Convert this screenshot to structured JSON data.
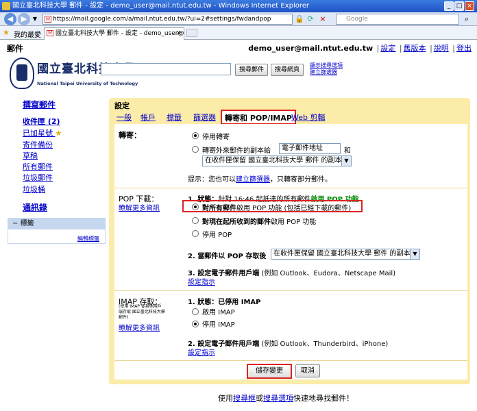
{
  "browser": {
    "window_title": "國立臺北科技大學 郵件 - 設定 - demo_user@mail.ntut.edu.tw - Windows Internet Explorer",
    "url": "https://mail.google.com/a/mail.ntut.edu.tw/?ui=2#settings/fwdandpop",
    "search_placeholder": "Google",
    "favorites_label": "我的最愛",
    "tab_title": "國立臺北科技大學 郵件 - 設定 - demo_user@mail.nt..."
  },
  "header": {
    "app_name": "郵件",
    "user_email": "demo_user@mail.ntut.edu.tw",
    "links": [
      "設定",
      "舊版本",
      "說明",
      "登出"
    ]
  },
  "logo": {
    "chinese": "國立臺北科技大學",
    "english": "National Taipei University of Technology"
  },
  "search": {
    "search_mail": "搜尋郵件",
    "search_web": "搜尋網頁",
    "options_line1": "顯示搜尋選項",
    "options_line2": "建立篩選器"
  },
  "sidebar": {
    "compose": "撰寫郵件",
    "inbox": "收件匣 (2)",
    "items": [
      "已加星號",
      "寄件備份",
      "草稿",
      "所有郵件",
      "垃圾郵件",
      "垃圾桶"
    ],
    "contacts": "通訊錄",
    "labels_title": "標籤",
    "labels_edit": "編輯標籤"
  },
  "settings": {
    "title": "設定",
    "tabs": [
      "一般",
      "帳戶",
      "標籤",
      "篩選器",
      "轉寄和 POP/IMAP",
      "Web 剪輯"
    ],
    "forwarding": {
      "label": "轉寄：",
      "disable": "停用轉寄",
      "forward_copy": "轉寄外來郵件的副本給",
      "email_input": "電子郵件地址",
      "and": "和",
      "keep_option": "在收件匣保留 國立臺北科技大學 郵件 的副本",
      "tip_prefix": "提示：您也可以",
      "tip_link": "建立篩選器",
      "tip_suffix": "，只轉寄部分郵件。"
    },
    "pop": {
      "label": "POP 下載：",
      "learn_more": "瞭解更多資訊",
      "status_prefix": "1. 狀態：",
      "status_text": "針對 16:46 起抵達的所有郵件",
      "status_enabled": "啟用 POP 功能",
      "opt_all_bold": "對所有郵件",
      "opt_all_rest": "啟用 POP 功能 (包括已經下載的郵件)",
      "opt_now_bold": "對現在起所收到的郵件",
      "opt_now_rest": "啟用 POP 功能",
      "opt_disable": "停用 POP",
      "step2": "2. 當郵件以 POP 存取後",
      "step2_select": "在收件匣保留 國立臺北科技大學 郵件 的副本",
      "step3": "3. 設定電子郵件用戶端",
      "step3_clients": "(例如 Outlook、Eudora、Netscape Mail)",
      "step3_link": "設定指示"
    },
    "imap": {
      "label": "IMAP 存取：",
      "note": "(使用 IMAP 從其他用戶端存取 國立臺北科技大學 郵件)",
      "learn_more": "瞭解更多資訊",
      "status_prefix": "1. 狀態：",
      "status_value": "已停用 IMAP",
      "opt_enable": "啟用 IMAP",
      "opt_disable": "停用 IMAP",
      "step2": "2. 設定電子郵件用戶端",
      "step2_clients": "(例如 Outlook、Thunderbird、iPhone)",
      "step2_link": "設定指示"
    },
    "save": "儲存變更",
    "cancel": "取消"
  },
  "footer": {
    "prefix": "使用",
    "link1": "搜尋框",
    "mid": "或",
    "link2": "搜尋選項",
    "suffix": "快速地尋找郵件！"
  },
  "colors": {
    "panel": "#fcecaa",
    "link": "#0000cc",
    "highlight": "#dd2222",
    "enabled": "#008800"
  }
}
